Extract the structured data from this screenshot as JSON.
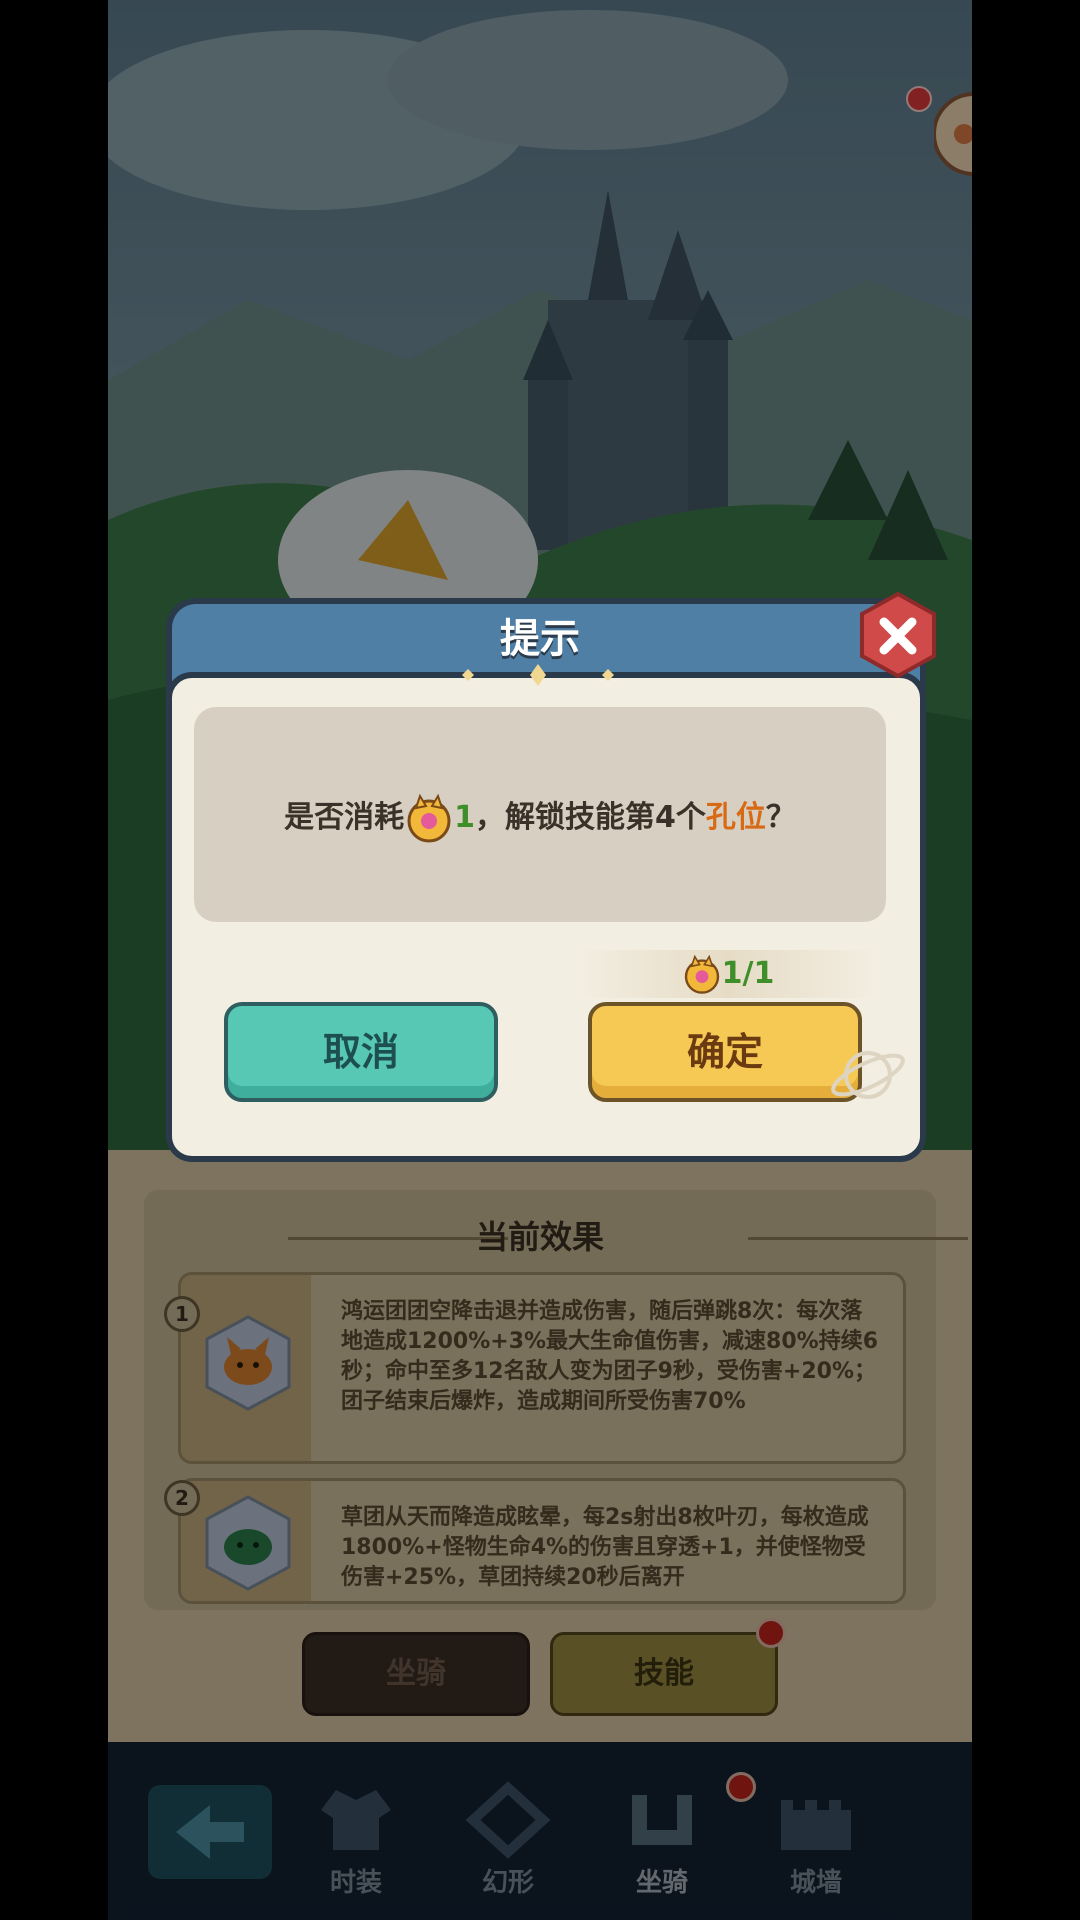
{
  "dialog": {
    "title": "提示",
    "message_prefix": "是否消耗",
    "cost_amount": "1",
    "message_middle": "，解锁技能第4个",
    "message_highlight": "孔位",
    "message_suffix": "？",
    "owned_count": "1/1",
    "cancel_label": "取消",
    "confirm_label": "确定",
    "close_icon": "close-icon",
    "cost_icon": "star-badge-icon"
  },
  "effects_panel": {
    "title": "当前效果",
    "items": [
      {
        "index": "1",
        "icon": "orange-creature-icon",
        "text": "鸿运团团空降击退并造成伤害，随后弹跳8次：每次落地造成1200%+3%最大生命值伤害，减速80%持续6秒；命中至多12名敌人变为团子9秒，受伤害+20%；团子结束后爆炸，造成期间所受伤害70%"
      },
      {
        "index": "2",
        "icon": "green-creature-icon",
        "text": "草团从天而降造成眩晕，每2s射出8枚叶刃，每枚造成1800%+怪物生命4%的伤害且穿透+1，并使怪物受伤害+25%，草团持续20秒后离开"
      }
    ]
  },
  "tabs": {
    "mount": "坐骑",
    "skill": "技能"
  },
  "bottom_nav": {
    "back_icon": "back-arrow-icon",
    "items": [
      {
        "label": "时装",
        "icon": "costume-icon"
      },
      {
        "label": "幻形",
        "icon": "transform-icon"
      },
      {
        "label": "坐骑",
        "icon": "mount-icon"
      },
      {
        "label": "城墙",
        "icon": "castle-wall-icon"
      }
    ]
  },
  "colors": {
    "accent_green": "#3e8f2a",
    "accent_orange": "#d86a16",
    "header_blue": "#4f7fa5"
  }
}
